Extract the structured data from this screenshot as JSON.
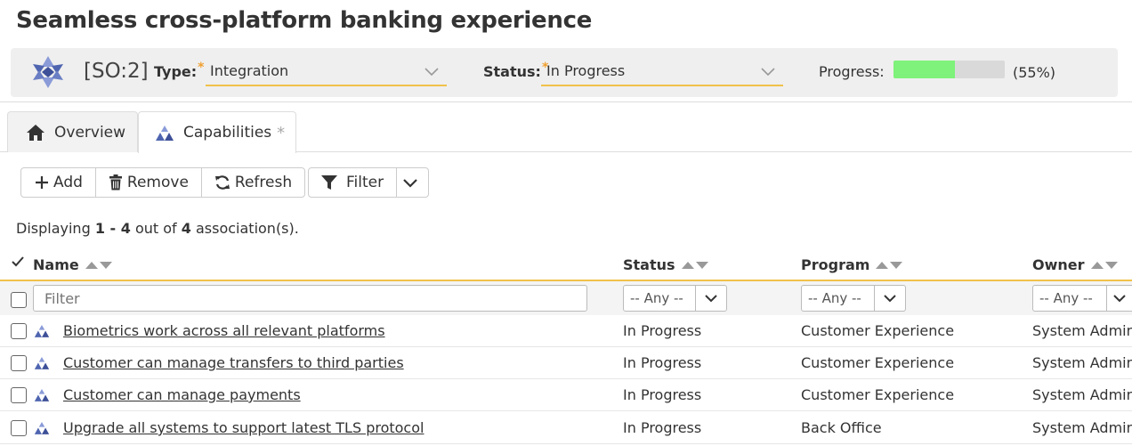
{
  "page": {
    "title": "Seamless cross-platform banking experience"
  },
  "header": {
    "token": "[SO:2]",
    "type_label": "Type:",
    "type_required": "*",
    "type_value": "Integration",
    "status_label": "Status:",
    "status_required": "*",
    "status_value": "In Progress",
    "progress_label": "Progress:",
    "progress_value": 0.55,
    "progress_text": "(55%)"
  },
  "tabs": [
    {
      "label": "Overview",
      "icon": "home-icon"
    },
    {
      "label": "Capabilities",
      "icon": "capability-icon",
      "marker": "*"
    }
  ],
  "toolbar": {
    "add_label": "Add",
    "remove_label": "Remove",
    "refresh_label": "Refresh",
    "filter_label": "Filter"
  },
  "display": {
    "prefix": "Displaying ",
    "range": "1 - 4",
    "middle": " out of ",
    "total": "4",
    "suffix": " association(s)."
  },
  "grid": {
    "columns": [
      "Name",
      "Status",
      "Program",
      "Owner"
    ],
    "filter_placeholder": "Filter",
    "any_option": "-- Any --",
    "rows": [
      {
        "name": "Biometrics work across all relevant platforms",
        "status": "In Progress",
        "program": "Customer Experience",
        "owner": "System Administrator"
      },
      {
        "name": "Customer can manage transfers to third parties",
        "status": "In Progress",
        "program": "Customer Experience",
        "owner": "System Administrator"
      },
      {
        "name": "Customer can manage payments",
        "status": "In Progress",
        "program": "Customer Experience",
        "owner": "System Administrator"
      },
      {
        "name": "Upgrade all systems to support latest TLS protocol",
        "status": "In Progress",
        "program": "Back Office",
        "owner": "System Administrator"
      }
    ]
  },
  "colors": {
    "accent": "#f0c24a",
    "progress": "#7ef27a",
    "icon": "#5b6fb5"
  }
}
